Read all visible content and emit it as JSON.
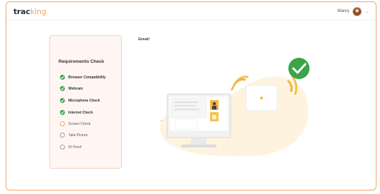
{
  "header": {
    "logo_part1": "trac",
    "logo_part2": "king",
    "user_name": "Manoj"
  },
  "requirements": {
    "title": "Requirements Check",
    "items": [
      {
        "label": "Browser Compatibility",
        "status": "done"
      },
      {
        "label": "Webcam",
        "status": "done"
      },
      {
        "label": "Microphone Check",
        "status": "done"
      },
      {
        "label": "Internet Check",
        "status": "done"
      },
      {
        "label": "Screen Check",
        "status": "in-progress"
      },
      {
        "label": "Take Picture",
        "status": "pending"
      },
      {
        "label": "ID Proof",
        "status": "pending"
      }
    ]
  },
  "main": {
    "message": "Great!"
  },
  "colors": {
    "accent": "#f5a25d",
    "success": "#39a24a",
    "card_bg": "#fff6f3",
    "blob": "#fdf3df"
  }
}
